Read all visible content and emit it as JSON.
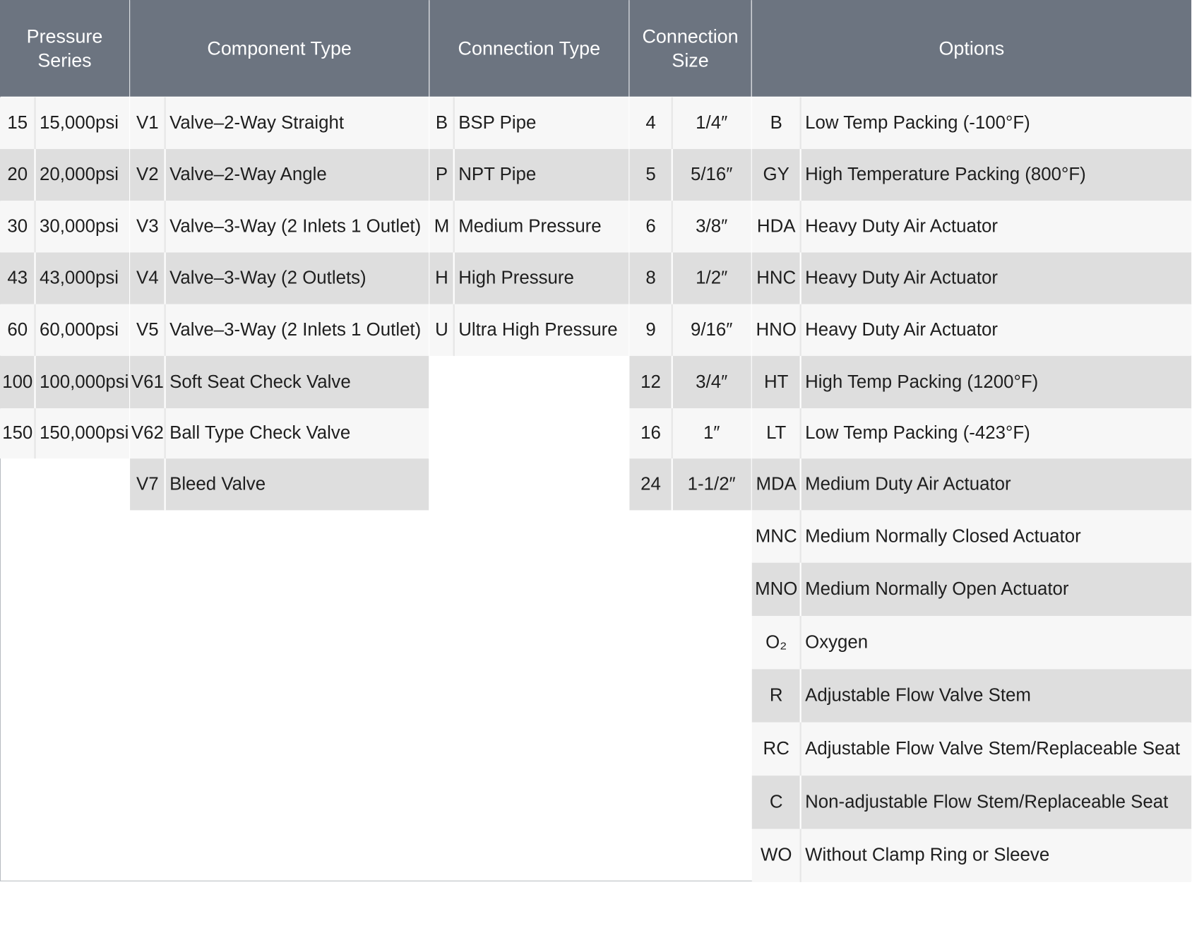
{
  "headers": {
    "pressure_series": "Pressure\nSeries",
    "component_type": "Component Type",
    "connection_type": "Connection Type",
    "connection_size": "Connection\nSize",
    "options": "Options"
  },
  "pressure_series": [
    {
      "code": "15",
      "desc": "15,000psi"
    },
    {
      "code": "20",
      "desc": "20,000psi"
    },
    {
      "code": "30",
      "desc": "30,000psi"
    },
    {
      "code": "43",
      "desc": "43,000psi"
    },
    {
      "code": "60",
      "desc": "60,000psi"
    },
    {
      "code": "100",
      "desc": "100,000psi"
    },
    {
      "code": "150",
      "desc": "150,000psi"
    }
  ],
  "component_types": [
    {
      "code": "V1",
      "desc": "Valve–2-Way Straight"
    },
    {
      "code": "V2",
      "desc": "Valve–2-Way Angle"
    },
    {
      "code": "V3",
      "desc": "Valve–3-Way (2 Inlets 1 Outlet)"
    },
    {
      "code": "V4",
      "desc": "Valve–3-Way (2 Outlets)"
    },
    {
      "code": "V5",
      "desc": "Valve–3-Way (2 Inlets 1 Outlet)"
    },
    {
      "code": "V61",
      "desc": "Soft Seat Check Valve"
    },
    {
      "code": "V62",
      "desc": "Ball Type Check Valve"
    },
    {
      "code": "V7",
      "desc": "Bleed Valve"
    }
  ],
  "connection_types": [
    {
      "code": "B",
      "desc": "BSP Pipe"
    },
    {
      "code": "P",
      "desc": "NPT Pipe"
    },
    {
      "code": "M",
      "desc": "Medium Pressure"
    },
    {
      "code": "H",
      "desc": "High Pressure"
    },
    {
      "code": "U",
      "desc": "Ultra High Pressure"
    }
  ],
  "connection_sizes": [
    {
      "code": "4",
      "desc": "1/4″"
    },
    {
      "code": "5",
      "desc": "5/16″"
    },
    {
      "code": "6",
      "desc": "3/8″"
    },
    {
      "code": "8",
      "desc": "1/2″"
    },
    {
      "code": "9",
      "desc": "9/16″"
    },
    {
      "code": "12",
      "desc": "3/4″"
    },
    {
      "code": "16",
      "desc": "1″"
    },
    {
      "code": "24",
      "desc": "1-1/2″"
    }
  ],
  "options": [
    {
      "code": "B",
      "desc": "Low Temp Packing (-100°F)"
    },
    {
      "code": "GY",
      "desc": "High Temperature Packing (800°F)"
    },
    {
      "code": "HDA",
      "desc": "Heavy Duty Air Actuator"
    },
    {
      "code": "HNC",
      "desc": "Heavy Duty Air Actuator"
    },
    {
      "code": "HNO",
      "desc": "Heavy Duty Air Actuator"
    },
    {
      "code": "HT",
      "desc": "High Temp Packing (1200°F)"
    },
    {
      "code": "LT",
      "desc": "Low Temp Packing (-423°F)"
    },
    {
      "code": "MDA",
      "desc": "Medium Duty Air Actuator"
    },
    {
      "code": "MNC",
      "desc": "Medium Normally Closed Actuator"
    },
    {
      "code": "MNO",
      "desc": "Medium Normally Open Actuator"
    },
    {
      "code": "O₂",
      "desc": "Oxygen"
    },
    {
      "code": "R",
      "desc": "Adjustable Flow Valve Stem"
    },
    {
      "code": "RC",
      "desc": "Adjustable Flow Valve Stem/Replaceable Seat"
    },
    {
      "code": "C",
      "desc": "Non-adjustable Flow Stem/Replaceable Seat"
    },
    {
      "code": "WO",
      "desc": "Without Clamp Ring or Sleeve"
    }
  ]
}
